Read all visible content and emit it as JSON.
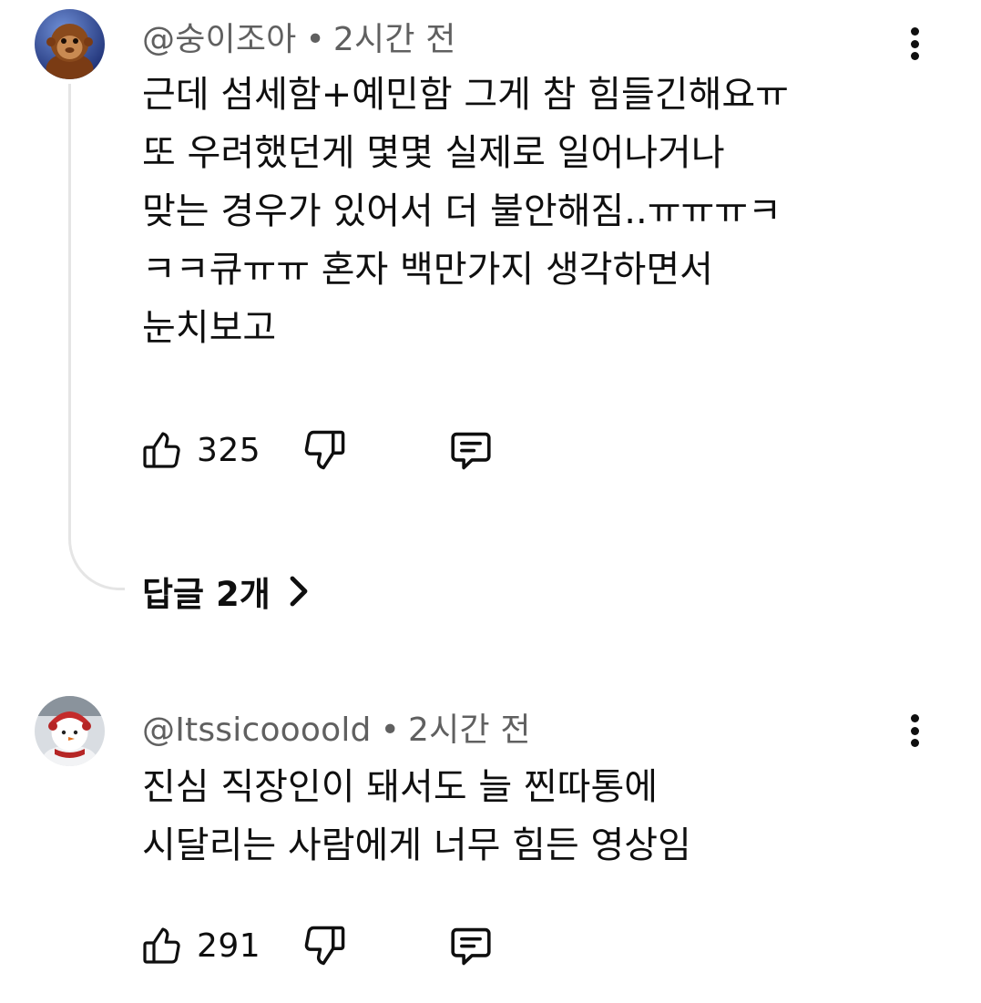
{
  "comments": [
    {
      "author": "@숭이조아",
      "separator": "•",
      "time": "2시간 전",
      "avatar_icon": "orangutan-avatar",
      "text": "근데 섬세함+예민함 그게 참 힘들긴해요ㅠ\n또 우려했던게 몇몇 실제로 일어나거나\n맞는 경우가 있어서 더 불안해짐..ㅠㅠㅠㅋ\nㅋㅋ큐ㅠㅠ 혼자 백만가지 생각하면서\n눈치보고",
      "likes": "325",
      "replies_label": "답글 2개"
    },
    {
      "author": "@Itssicoooold",
      "separator": "•",
      "time": "2시간 전",
      "avatar_icon": "snowman-avatar",
      "text": "진심 직장인이 돼서도 늘 찐따통에\n시달리는 사람에게 너무 힘든 영상임",
      "likes": "291"
    }
  ],
  "colors": {
    "primary_text": "#0f0f0f",
    "secondary_text": "#606060",
    "thread_line": "#e5e5e5",
    "background": "#ffffff"
  },
  "icons": [
    "like-icon",
    "dislike-icon",
    "reply-icon",
    "more-options-icon",
    "chevron-right-icon"
  ]
}
